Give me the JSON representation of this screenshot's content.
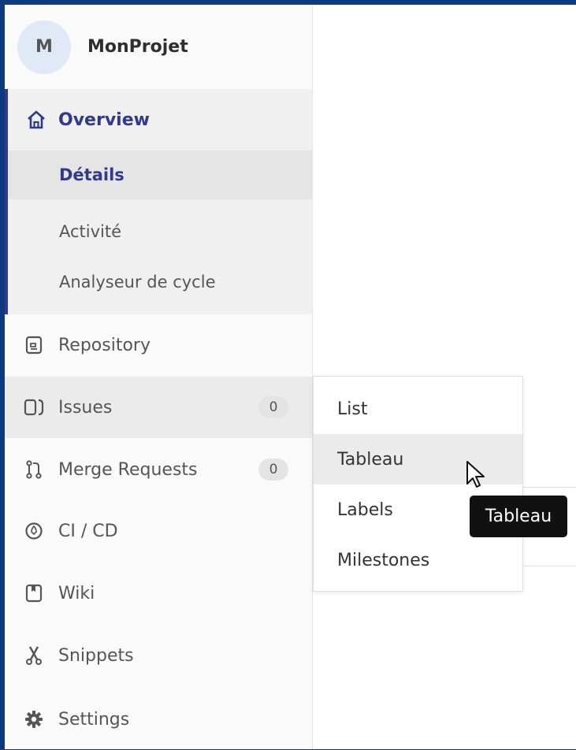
{
  "project": {
    "avatar_letter": "M",
    "name": "MonProjet"
  },
  "overview": {
    "label": "Overview",
    "icon": "home-icon",
    "subitems": [
      {
        "label": "Détails",
        "active": true
      },
      {
        "label": "Activité",
        "active": false
      },
      {
        "label": "Analyseur de cycle",
        "active": false
      }
    ]
  },
  "nav": [
    {
      "label": "Repository",
      "icon": "document-icon"
    },
    {
      "label": "Issues",
      "icon": "issues-icon",
      "badge": "0"
    },
    {
      "label": "Merge Requests",
      "icon": "merge-request-icon",
      "badge": "0"
    },
    {
      "label": "CI / CD",
      "icon": "rocket-icon"
    },
    {
      "label": "Wiki",
      "icon": "book-icon"
    },
    {
      "label": "Snippets",
      "icon": "scissors-icon"
    },
    {
      "label": "Settings",
      "icon": "gear-icon"
    }
  ],
  "flyout": {
    "items": [
      {
        "label": "List"
      },
      {
        "label": "Tableau"
      },
      {
        "label": "Labels"
      },
      {
        "label": "Milestones"
      }
    ]
  },
  "tooltip": {
    "text": "Tableau"
  },
  "colors": {
    "accent": "#2f3a8f",
    "frame": "#0d3a7d"
  }
}
